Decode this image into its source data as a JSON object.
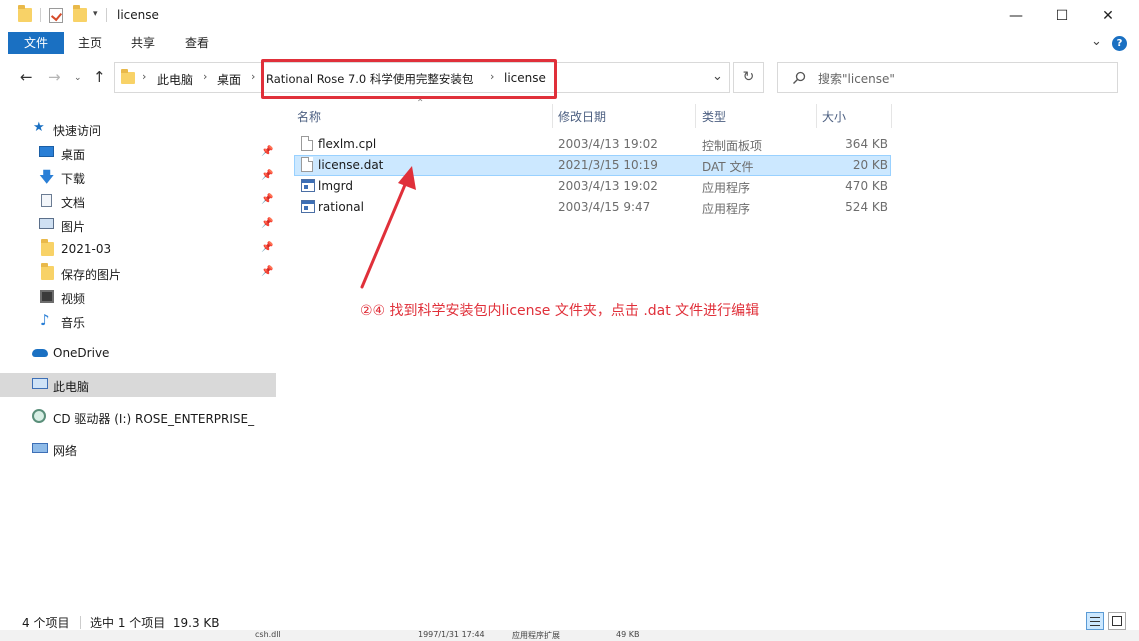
{
  "window": {
    "title": "license",
    "minimize_glyph": "—",
    "maximize_glyph": "☐",
    "close_glyph": "✕"
  },
  "ribbon": {
    "tabs": [
      "文件",
      "主页",
      "共享",
      "查看"
    ],
    "collapse_glyph": "⌄",
    "help_glyph": "?"
  },
  "address": {
    "crumbs": [
      "此电脑",
      "桌面",
      "Rational Rose 7.0 科学使用完整安装包",
      "license"
    ],
    "separator": "›",
    "dropdown_glyph": "⌄",
    "refresh_glyph": "↻"
  },
  "search": {
    "placeholder": "搜索\"license\""
  },
  "sidebar": {
    "quick_access": "快速访问",
    "items": [
      "桌面",
      "下载",
      "文档",
      "图片",
      "2021-03",
      "保存的图片",
      "视频",
      "音乐"
    ],
    "onedrive": "OneDrive",
    "this_pc": "此电脑",
    "cd_drive": "CD 驱动器 (I:) ROSE_ENTERPRISE_",
    "network": "网络"
  },
  "columns": {
    "name": "名称",
    "modified": "修改日期",
    "type": "类型",
    "size": "大小"
  },
  "files": [
    {
      "name": "flexlm.cpl",
      "modified": "2003/4/13 19:02",
      "type": "控制面板项",
      "size": "364 KB",
      "icon": "control-panel-icon"
    },
    {
      "name": "license.dat",
      "modified": "2021/3/15 10:19",
      "type": "DAT 文件",
      "size": "20 KB",
      "icon": "document-icon"
    },
    {
      "name": "lmgrd",
      "modified": "2003/4/13 19:02",
      "type": "应用程序",
      "size": "470 KB",
      "icon": "application-icon"
    },
    {
      "name": "rational",
      "modified": "2003/4/15 9:47",
      "type": "应用程序",
      "size": "524 KB",
      "icon": "application-icon"
    }
  ],
  "annotation": "②④ 找到科学安装包内license 文件夹，点击 .dat 文件进行编辑",
  "status": {
    "count": "4 个项目",
    "selected": "选中 1 个项目  19.3 KB"
  },
  "bottom_strip": {
    "file": "csh.dll",
    "date": "1997/1/31 17:44",
    "type": "应用程序扩展",
    "size": "49 KB"
  },
  "colors": {
    "accent": "#1a70c2",
    "highlight": "#e0303a",
    "selection": "#cce8ff"
  }
}
